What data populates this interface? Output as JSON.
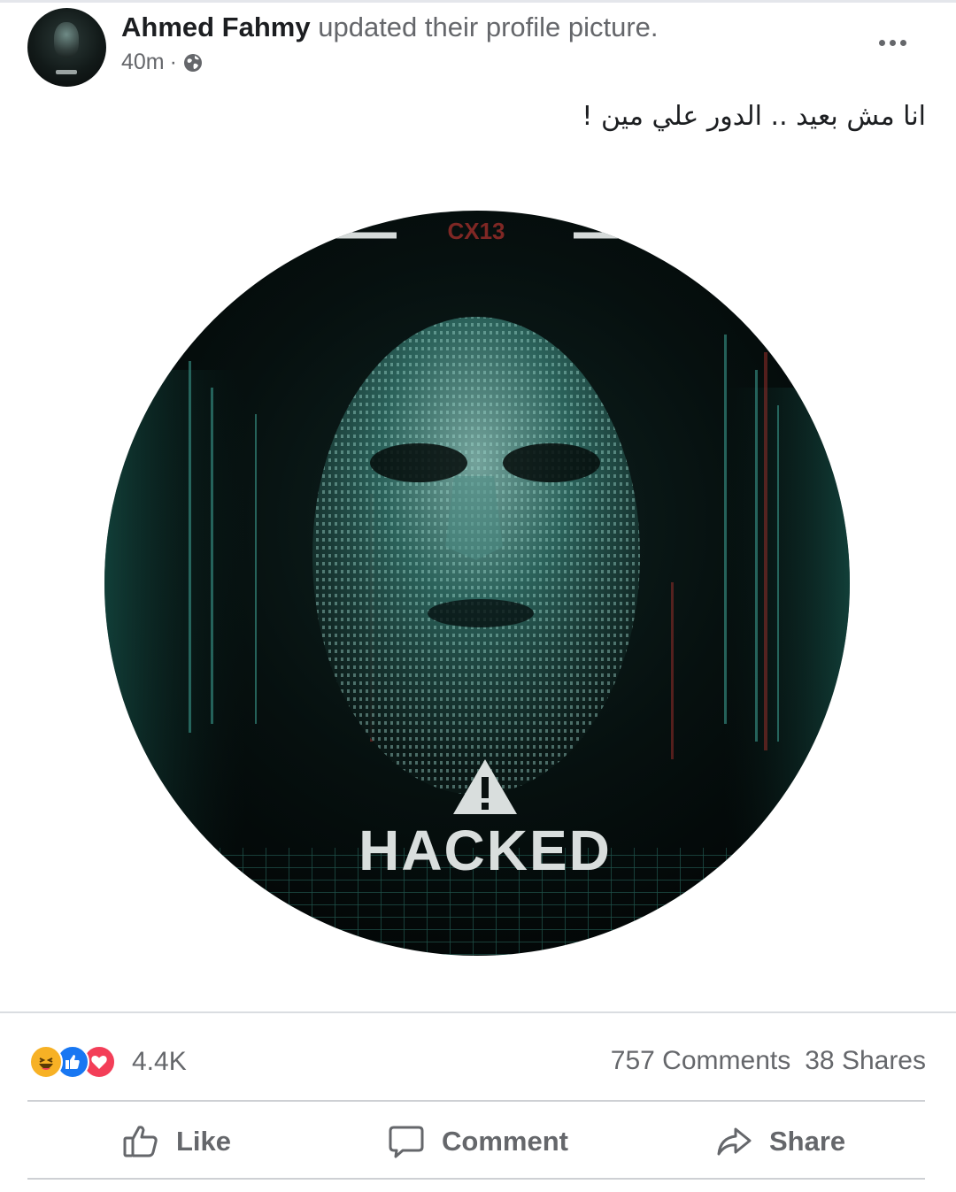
{
  "post": {
    "author": "Ahmed Fahmy",
    "action": "updated their profile picture.",
    "time": "40m",
    "separator": "·",
    "privacy_icon": "globe-icon",
    "more_icon": "more-options-icon",
    "text": "انا مش بعيد .. الدور علي مين !"
  },
  "image": {
    "badge_text": "CX13",
    "hacked_text": "HACKED",
    "warning_icon": "warning-icon",
    "colors": {
      "background": "#050c0b",
      "glow": "#2f8f80",
      "accent_red": "#b3322e",
      "text": "#d9dedd"
    }
  },
  "stats": {
    "reaction_icons": [
      "haha-icon",
      "like-icon",
      "love-icon"
    ],
    "reactions_count": "4.4K",
    "comments": "757 Comments",
    "shares": "38 Shares"
  },
  "actions": {
    "like": "Like",
    "comment": "Comment",
    "share": "Share"
  }
}
